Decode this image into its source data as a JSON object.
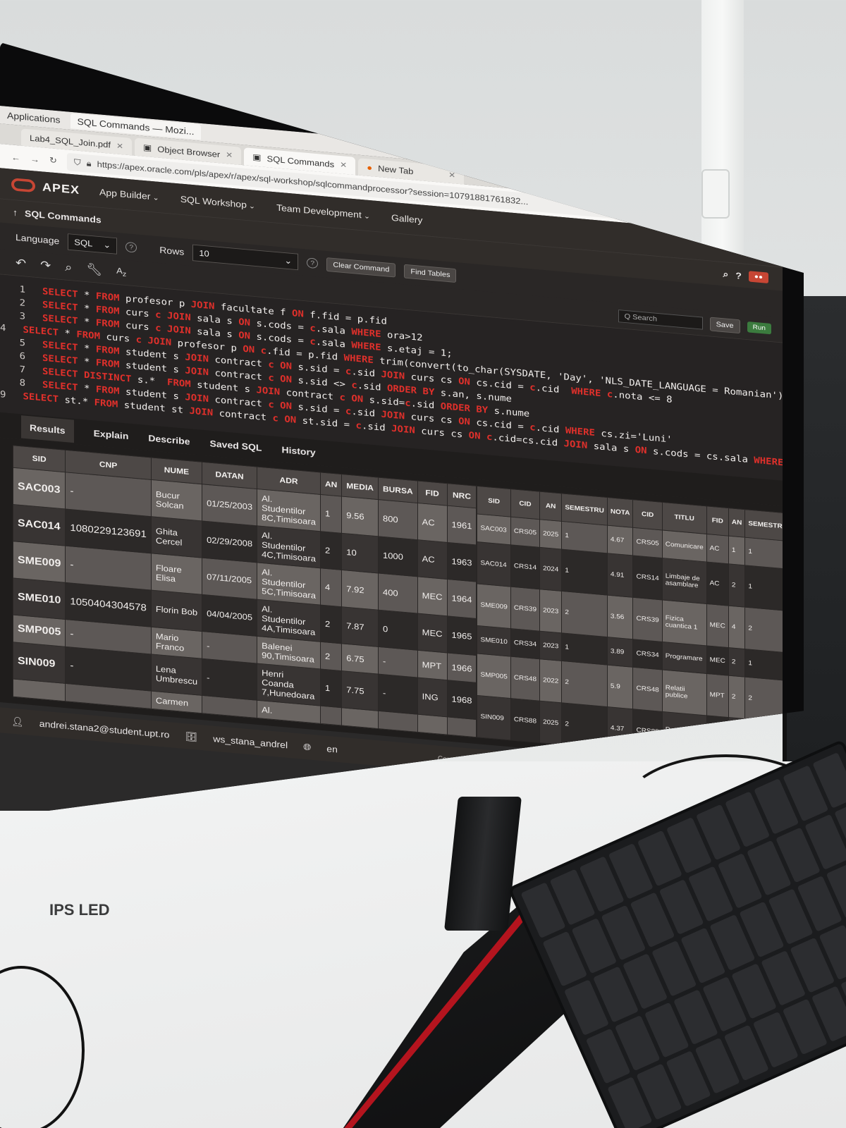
{
  "os": {
    "menu": "Applications",
    "window_title": "SQL Commands — Mozi...",
    "pdf_title": "Lab4_SQL_Join.pdf"
  },
  "browser": {
    "tabs": [
      {
        "label": "Lab4_SQL_Join.pdf"
      },
      {
        "label": "Object Browser"
      },
      {
        "label": "SQL Commands"
      },
      {
        "label": "New Tab"
      }
    ],
    "url": "https://apex.oracle.com/pls/apex/r/apex/sql-workshop/sqlcommandprocessor?session=10791881761832..."
  },
  "apex": {
    "brand": "APEX",
    "nav": [
      "App Builder",
      "SQL Workshop",
      "Team Development",
      "Gallery"
    ],
    "page_title": "SQL Commands"
  },
  "toolbar": {
    "language_label": "Language",
    "language_value": "SQL",
    "rows_label": "Rows",
    "rows_value": "10",
    "clear_command": "Clear Command",
    "find_tables": "Find Tables",
    "search_placeholder": "Q Search",
    "run": "Run",
    "save": "Save"
  },
  "editor": {
    "lines": [
      [
        {
          "k": 1,
          "t": "SELECT"
        },
        {
          "t": " * "
        },
        {
          "k": 1,
          "t": "FROM"
        },
        {
          "t": " profesor p "
        },
        {
          "k": 1,
          "t": "JOIN"
        },
        {
          "t": " facultate f "
        },
        {
          "k": 1,
          "t": "ON"
        },
        {
          "t": " f.fid = p.fid"
        }
      ],
      [
        {
          "k": 1,
          "t": "SELECT"
        },
        {
          "t": " * "
        },
        {
          "k": 1,
          "t": "FROM"
        },
        {
          "t": " curs "
        },
        {
          "k": 1,
          "t": "c JOIN"
        },
        {
          "t": " sala s "
        },
        {
          "k": 1,
          "t": "ON"
        },
        {
          "t": " s.cods = "
        },
        {
          "k": 1,
          "t": "c"
        },
        {
          "t": ".sala "
        },
        {
          "k": 1,
          "t": "WHERE"
        },
        {
          "t": " ora>12"
        }
      ],
      [
        {
          "k": 1,
          "t": "SELECT"
        },
        {
          "t": " * "
        },
        {
          "k": 1,
          "t": "FROM"
        },
        {
          "t": " curs "
        },
        {
          "k": 1,
          "t": "c JOIN"
        },
        {
          "t": " sala s "
        },
        {
          "k": 1,
          "t": "ON"
        },
        {
          "t": " s.cods = "
        },
        {
          "k": 1,
          "t": "c"
        },
        {
          "t": ".sala "
        },
        {
          "k": 1,
          "t": "WHERE"
        },
        {
          "t": " s.etaj = 1;"
        }
      ],
      [
        {
          "k": 1,
          "t": "SELECT"
        },
        {
          "t": " * "
        },
        {
          "k": 1,
          "t": "FROM"
        },
        {
          "t": " curs "
        },
        {
          "k": 1,
          "t": "c JOIN"
        },
        {
          "t": " profesor p "
        },
        {
          "k": 1,
          "t": "ON"
        },
        {
          "t": " "
        },
        {
          "k": 1,
          "t": "c"
        },
        {
          "t": ".fid = p.fid "
        },
        {
          "k": 1,
          "t": "WHERE"
        },
        {
          "t": " trim(convert(to_char(SYSDATE, 'Day', 'NLS_DATE_LANGUAGE = Romanian'),'US7ASCII')) = "
        },
        {
          "k": 1,
          "t": "c"
        },
        {
          "t": ".zi"
        }
      ],
      [
        {
          "k": 1,
          "t": "SELECT"
        },
        {
          "t": " * "
        },
        {
          "k": 1,
          "t": "FROM"
        },
        {
          "t": " student s "
        },
        {
          "k": 1,
          "t": "JOIN"
        },
        {
          "t": " contract "
        },
        {
          "k": 1,
          "t": "c ON"
        },
        {
          "t": " s.sid = "
        },
        {
          "k": 1,
          "t": "c"
        },
        {
          "t": ".sid "
        },
        {
          "k": 1,
          "t": "JOIN"
        },
        {
          "t": " curs cs "
        },
        {
          "k": 1,
          "t": "ON"
        },
        {
          "t": " cs.cid = "
        },
        {
          "k": 1,
          "t": "c"
        },
        {
          "t": ".cid  "
        },
        {
          "k": 1,
          "t": "WHERE"
        },
        {
          "t": " "
        },
        {
          "k": 1,
          "t": "c"
        },
        {
          "t": ".nota <= 8"
        }
      ],
      [
        {
          "k": 1,
          "t": "SELECT"
        },
        {
          "t": " * "
        },
        {
          "k": 1,
          "t": "FROM"
        },
        {
          "t": " student s "
        },
        {
          "k": 1,
          "t": "JOIN"
        },
        {
          "t": " contract "
        },
        {
          "k": 1,
          "t": "c ON"
        },
        {
          "t": " s.sid <> "
        },
        {
          "k": 1,
          "t": "c"
        },
        {
          "t": ".sid "
        },
        {
          "k": 1,
          "t": "ORDER BY"
        },
        {
          "t": " s.an, s.nume"
        }
      ],
      [
        {
          "k": 1,
          "t": "SELECT DISTINCT"
        },
        {
          "t": " s.*  "
        },
        {
          "k": 1,
          "t": "FROM"
        },
        {
          "t": " student s "
        },
        {
          "k": 1,
          "t": "JOIN"
        },
        {
          "t": " contract "
        },
        {
          "k": 1,
          "t": "c ON"
        },
        {
          "t": " s.sid="
        },
        {
          "k": 1,
          "t": "c"
        },
        {
          "t": ".sid "
        },
        {
          "k": 1,
          "t": "ORDER BY"
        },
        {
          "t": " s.nume"
        }
      ],
      [
        {
          "k": 1,
          "t": "SELECT"
        },
        {
          "t": " * "
        },
        {
          "k": 1,
          "t": "FROM"
        },
        {
          "t": " student s "
        },
        {
          "k": 1,
          "t": "JOIN"
        },
        {
          "t": " contract "
        },
        {
          "k": 1,
          "t": "c ON"
        },
        {
          "t": " s.sid = "
        },
        {
          "k": 1,
          "t": "c"
        },
        {
          "t": ".sid "
        },
        {
          "k": 1,
          "t": "JOIN"
        },
        {
          "t": " curs cs "
        },
        {
          "k": 1,
          "t": "ON"
        },
        {
          "t": " cs.cid = "
        },
        {
          "k": 1,
          "t": "c"
        },
        {
          "t": ".cid "
        },
        {
          "k": 1,
          "t": "WHERE"
        },
        {
          "t": " cs.zi='Luni'"
        }
      ],
      [
        {
          "k": 1,
          "t": "SELECT"
        },
        {
          "t": " st.* "
        },
        {
          "k": 1,
          "t": "FROM"
        },
        {
          "t": " student st "
        },
        {
          "k": 1,
          "t": "JOIN"
        },
        {
          "t": " contract "
        },
        {
          "k": 1,
          "t": "c ON"
        },
        {
          "t": " st.sid = "
        },
        {
          "k": 1,
          "t": "c"
        },
        {
          "t": ".sid "
        },
        {
          "k": 1,
          "t": "JOIN"
        },
        {
          "t": " curs cs "
        },
        {
          "k": 1,
          "t": "ON"
        },
        {
          "t": " "
        },
        {
          "k": 1,
          "t": "c"
        },
        {
          "t": ".cid=cs.cid "
        },
        {
          "k": 1,
          "t": "JOIN"
        },
        {
          "t": " sala s "
        },
        {
          "k": 1,
          "t": "ON"
        },
        {
          "t": " s.cods = cs.sala "
        },
        {
          "k": 1,
          "t": "WHERE"
        },
        {
          "t": " s.nrlocuri < 200"
        }
      ]
    ]
  },
  "results": {
    "tabs": [
      "Results",
      "Explain",
      "Describe",
      "Saved SQL",
      "History"
    ],
    "columns": [
      "SID",
      "CNP",
      "NUME",
      "DATAN",
      "ADR",
      "AN",
      "MEDIA",
      "BURSA",
      "FID",
      "NRC"
    ],
    "rows": [
      [
        "SAC003",
        "-",
        "Bucur Solcan",
        "01/25/2003",
        "Al. Studentilor 8C,Timisoara",
        "1",
        "9.56",
        "800",
        "AC",
        "1961"
      ],
      [
        "SAC014",
        "1080229123691",
        "Ghita Cercel",
        "02/29/2008",
        "Al. Studentilor 4C,Timisoara",
        "2",
        "10",
        "1000",
        "AC",
        "1963"
      ],
      [
        "SME009",
        "-",
        "Floare Elisa",
        "07/11/2005",
        "Al. Studentilor 5C,Timisoara",
        "4",
        "7.92",
        "400",
        "MEC",
        "1964"
      ],
      [
        "SME010",
        "1050404304578",
        "Florin Bob",
        "04/04/2005",
        "Al. Studentilor 4A,Timisoara",
        "2",
        "7.87",
        "0",
        "MEC",
        "1965"
      ],
      [
        "SMP005",
        "-",
        "Mario Franco",
        "-",
        "Balenei 90,Timisoara",
        "2",
        "6.75",
        "-",
        "MPT",
        "1966"
      ],
      [
        "SIN009",
        "-",
        "Lena Umbrescu",
        "-",
        "Henri Coanda 7,Hunedoara",
        "1",
        "7.75",
        "-",
        "ING",
        "1968"
      ],
      [
        "",
        "",
        "Carmen",
        "",
        "Al.",
        "",
        "",
        "",
        "",
        ""
      ]
    ],
    "columns2": [
      "SID",
      "CID",
      "AN",
      "SEMESTRU",
      "NOTA",
      "CID",
      "TITLU",
      "FID",
      "AN",
      "SEMESTRU"
    ],
    "rows2": [
      [
        "SAC003",
        "CRS05",
        "2025",
        "1",
        "4.67",
        "CRS05",
        "Comunicare",
        "AC",
        "1",
        "1"
      ],
      [
        "SAC014",
        "CRS14",
        "2024",
        "1",
        "4.91",
        "CRS14",
        "Limbaje de asamblare",
        "AC",
        "2",
        "1"
      ],
      [
        "SME009",
        "CRS39",
        "2023",
        "2",
        "3.56",
        "CRS39",
        "Fizica cuantica 1",
        "MEC",
        "4",
        "2"
      ],
      [
        "SME010",
        "CRS34",
        "2023",
        "1",
        "3.89",
        "CRS34",
        "Programare",
        "MEC",
        "2",
        "1"
      ],
      [
        "SMP005",
        "CRS48",
        "2022",
        "2",
        "5.9",
        "CRS48",
        "Relatii publice",
        "MPT",
        "2",
        "2"
      ],
      [
        "SIN009",
        "CRS88",
        "2025",
        "2",
        "4.37",
        "CRS88",
        "Programare 1",
        "ING",
        "1",
        "2"
      ]
    ]
  },
  "footer": {
    "user": "andrei.stana2@student.upt.ro",
    "workspace": "ws_stana_andrel",
    "language": "en",
    "copyright": "Copyright © 1999, 2025, Oracle and/or its affiliates."
  },
  "monitor": {
    "brand": "LG",
    "panel": "IPS LED"
  },
  "colors": {
    "accent": "#c74634",
    "keyword": "#e0302b",
    "apex_header": "#312d2a",
    "editor_bg": "#262323"
  }
}
